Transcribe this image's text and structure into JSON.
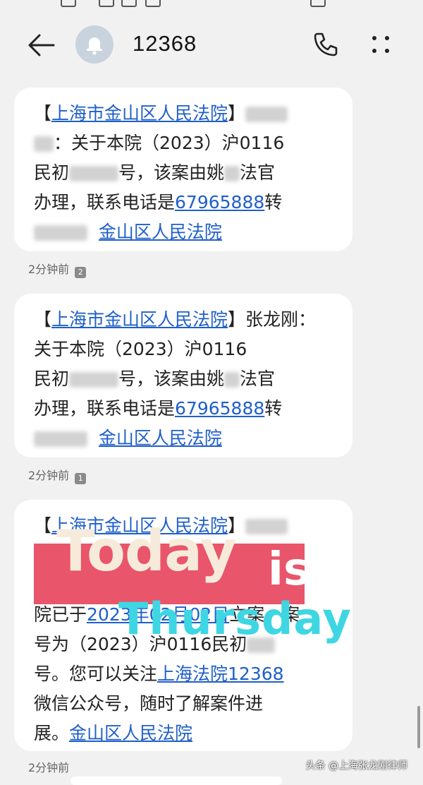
{
  "header": {
    "title": "12368"
  },
  "messages": [
    {
      "court": "上海市金山区人民法院",
      "bracket_open": "【",
      "bracket_close": "】",
      "text_a": "关于本院（2023）沪0116",
      "text_b1": "民初",
      "text_b2": "号，该案由姚",
      "text_b3": "法官",
      "text_c1": "办理，联系电话是",
      "phone": "67965888",
      "text_c2": "转",
      "signature": "金山区人民法院",
      "time": "2分钟前",
      "sim": "2"
    },
    {
      "court": "上海市金山区人民法院",
      "bracket_open": "【",
      "bracket_close": "】",
      "name": "张龙刚：",
      "text_a": "关于本院（2023）沪0116",
      "text_b1": "民初",
      "text_b2": "号，该案由姚",
      "text_b3": "法官",
      "text_c1": "办理，联系电话是",
      "phone": "67965888",
      "text_c2": "转",
      "signature": "金山区人民法院",
      "time": "2分钟前",
      "sim": "1"
    },
    {
      "court": "上海市金山区人民法院",
      "bracket_open": "【",
      "bracket_close": "】",
      "text_a": "院已于",
      "date": "2023年02月02日",
      "text_b": "立案，案",
      "text_c": "号为（2023）沪0116民初",
      "text_d": "号。您可以关注",
      "wechat": "上海法院12368",
      "text_e": "微信公众号，随时了解案件进",
      "text_f": "展。",
      "signature": "金山区人民法院",
      "time": "2分钟前"
    }
  ],
  "overlay": {
    "today": "Today",
    "is": "is",
    "thursday": "Thursday",
    "banner_color": "#e7475e",
    "thursday_color": "#3ed6e3"
  },
  "watermark": "头条 @上海张龙刚律师",
  "colors": {
    "link": "#1f5fc9",
    "bubble": "#ffffff",
    "background": "#f1f1f1"
  }
}
